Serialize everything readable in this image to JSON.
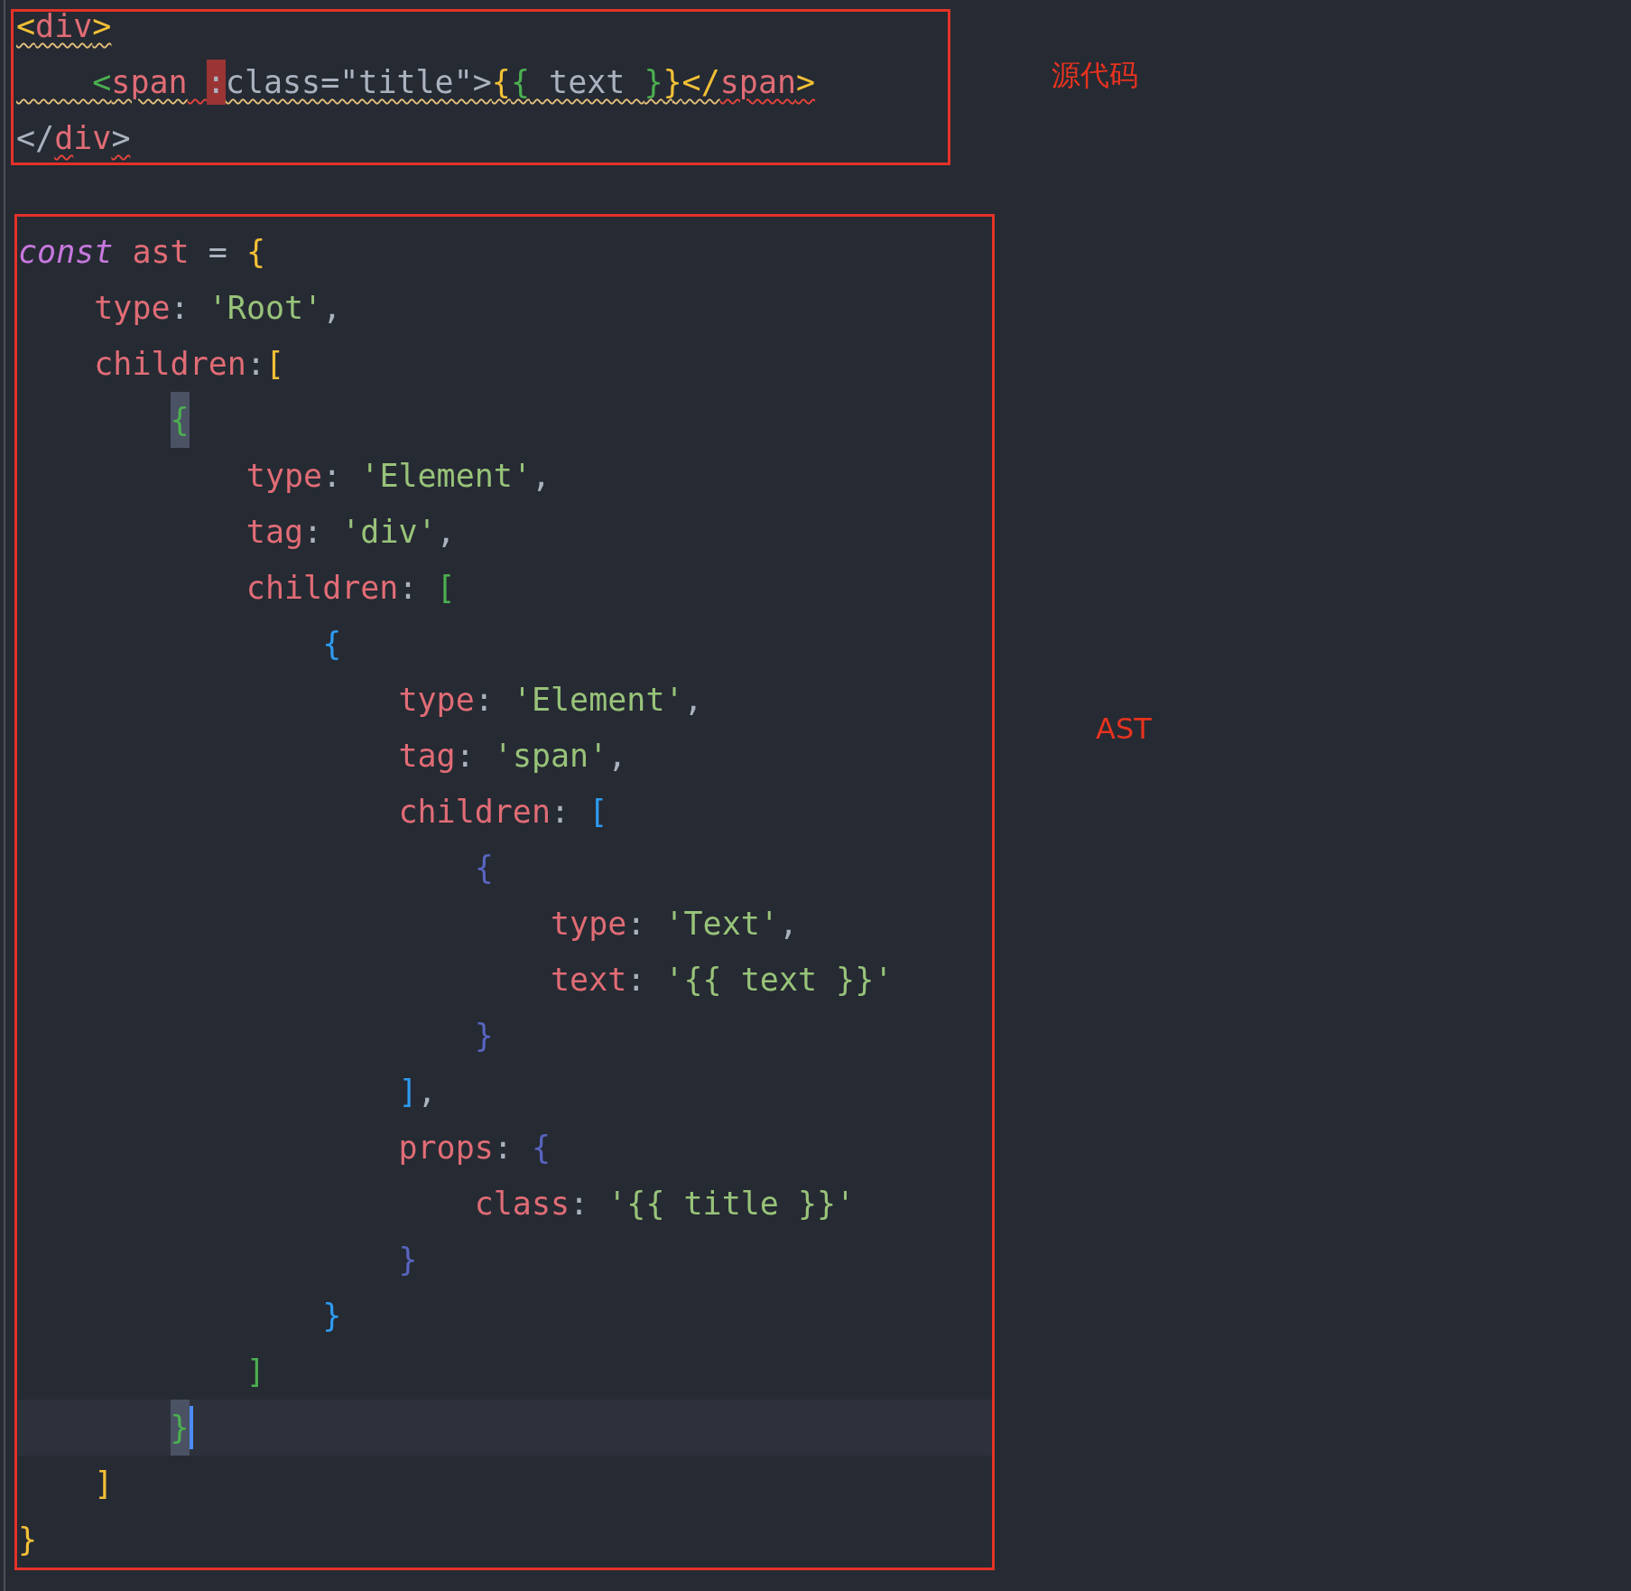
{
  "blocks": [
    {
      "label": "源代码",
      "lines": [
        {
          "tokens": [
            {
              "text": "<",
              "kind": "y",
              "warn_underline": true
            },
            {
              "text": "div",
              "kind": "key",
              "warn_underline": true
            },
            {
              "text": ">",
              "kind": "y",
              "warn_underline": true
            }
          ]
        },
        {
          "tokens": [
            {
              "text": "    <",
              "kind": "g",
              "warn_underline": true
            },
            {
              "text": "span",
              "kind": "key",
              "warn_underline": true
            },
            {
              "text": " :",
              "kind": "p",
              "error_highlight": true,
              "error_underline": true
            },
            {
              "text": "class=\"title\">",
              "kind": "p",
              "warn_underline": true
            },
            {
              "text": "{",
              "kind": "y",
              "warn_underline": true
            },
            {
              "text": "{",
              "kind": "g",
              "warn_underline": true
            },
            {
              "text": " text ",
              "kind": "p",
              "warn_underline": true
            },
            {
              "text": "}",
              "kind": "g",
              "warn_underline": true
            },
            {
              "text": "}",
              "kind": "y",
              "warn_underline": true
            },
            {
              "text": "</",
              "kind": "y",
              "warn_underline": true
            },
            {
              "text": "span",
              "kind": "key",
              "error_underline": true
            },
            {
              "text": ">",
              "kind": "y",
              "error_underline": true
            }
          ]
        },
        {
          "tokens": [
            {
              "text": "</",
              "kind": "p"
            },
            {
              "text": "d",
              "kind": "key",
              "error_underline": true
            },
            {
              "text": "iv",
              "kind": "key"
            },
            {
              "text": ">",
              "kind": "p",
              "error_underline": true
            }
          ]
        }
      ]
    },
    {
      "label": "AST",
      "lines": [
        {
          "tokens": [
            {
              "text": "const",
              "kind": "kw"
            },
            {
              "text": " ast",
              "kind": "key"
            },
            {
              "text": " = ",
              "kind": "p"
            },
            {
              "text": "{",
              "kind": "y"
            }
          ]
        },
        {
          "tokens": [
            {
              "text": "    type",
              "kind": "key"
            },
            {
              "text": ": ",
              "kind": "p"
            },
            {
              "text": "'Root'",
              "kind": "str"
            },
            {
              "text": ",",
              "kind": "p"
            }
          ]
        },
        {
          "tokens": [
            {
              "text": "    children",
              "kind": "key"
            },
            {
              "text": ":",
              "kind": "p"
            },
            {
              "text": "[",
              "kind": "y"
            }
          ]
        },
        {
          "tokens": [
            {
              "text": "        {",
              "kind": "g",
              "matched": true
            }
          ]
        },
        {
          "tokens": [
            {
              "text": "            type",
              "kind": "key"
            },
            {
              "text": ": ",
              "kind": "p"
            },
            {
              "text": "'Element'",
              "kind": "str"
            },
            {
              "text": ",",
              "kind": "p"
            }
          ]
        },
        {
          "tokens": [
            {
              "text": "            tag",
              "kind": "key"
            },
            {
              "text": ": ",
              "kind": "p"
            },
            {
              "text": "'div'",
              "kind": "str"
            },
            {
              "text": ",",
              "kind": "p"
            }
          ]
        },
        {
          "tokens": [
            {
              "text": "            children",
              "kind": "key"
            },
            {
              "text": ": ",
              "kind": "p"
            },
            {
              "text": "[",
              "kind": "g"
            }
          ]
        },
        {
          "tokens": [
            {
              "text": "                {",
              "kind": "b"
            }
          ]
        },
        {
          "tokens": [
            {
              "text": "                    type",
              "kind": "key"
            },
            {
              "text": ": ",
              "kind": "p"
            },
            {
              "text": "'Element'",
              "kind": "str"
            },
            {
              "text": ",",
              "kind": "p"
            }
          ]
        },
        {
          "tokens": [
            {
              "text": "                    tag",
              "kind": "key"
            },
            {
              "text": ": ",
              "kind": "p"
            },
            {
              "text": "'span'",
              "kind": "str"
            },
            {
              "text": ",",
              "kind": "p"
            }
          ]
        },
        {
          "tokens": [
            {
              "text": "                    children",
              "kind": "key"
            },
            {
              "text": ": ",
              "kind": "p"
            },
            {
              "text": "[",
              "kind": "b"
            }
          ]
        },
        {
          "tokens": [
            {
              "text": "                        {",
              "kind": "i"
            }
          ]
        },
        {
          "tokens": [
            {
              "text": "                            type",
              "kind": "key"
            },
            {
              "text": ": ",
              "kind": "p"
            },
            {
              "text": "'Text'",
              "kind": "str"
            },
            {
              "text": ",",
              "kind": "p"
            }
          ]
        },
        {
          "tokens": [
            {
              "text": "                            text",
              "kind": "key"
            },
            {
              "text": ": ",
              "kind": "p"
            },
            {
              "text": "'{{ text }}'",
              "kind": "str"
            }
          ]
        },
        {
          "tokens": [
            {
              "text": "                        }",
              "kind": "i"
            }
          ]
        },
        {
          "tokens": [
            {
              "text": "                    ]",
              "kind": "b"
            },
            {
              "text": ",",
              "kind": "p"
            }
          ]
        },
        {
          "tokens": [
            {
              "text": "                    props",
              "kind": "key"
            },
            {
              "text": ": ",
              "kind": "p"
            },
            {
              "text": "{",
              "kind": "i"
            }
          ]
        },
        {
          "tokens": [
            {
              "text": "                        class",
              "kind": "key"
            },
            {
              "text": ": ",
              "kind": "p"
            },
            {
              "text": "'{{ title }}'",
              "kind": "str"
            }
          ]
        },
        {
          "tokens": [
            {
              "text": "                    }",
              "kind": "i"
            }
          ]
        },
        {
          "tokens": [
            {
              "text": "                }",
              "kind": "b"
            }
          ]
        },
        {
          "tokens": [
            {
              "text": "            ]",
              "kind": "g"
            }
          ]
        },
        {
          "current": true,
          "tokens": [
            {
              "text": "        }",
              "kind": "g",
              "matched": true
            }
          ]
        },
        {
          "tokens": [
            {
              "text": "    ]",
              "kind": "y"
            }
          ]
        },
        {
          "tokens": [
            {
              "text": "}",
              "kind": "y"
            }
          ]
        }
      ]
    }
  ]
}
